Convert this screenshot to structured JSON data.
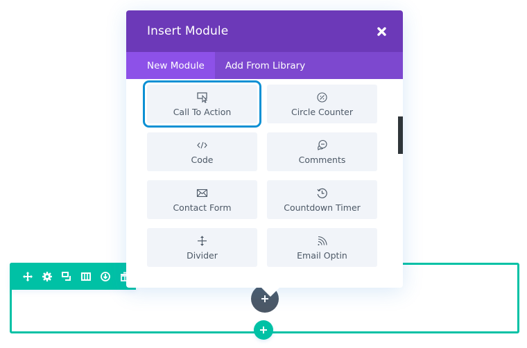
{
  "section": {
    "toolbar": {
      "icons": [
        {
          "name": "move-icon"
        },
        {
          "name": "gear-icon"
        },
        {
          "name": "duplicate-icon"
        },
        {
          "name": "columns-icon"
        },
        {
          "name": "save-to-library-icon"
        },
        {
          "name": "trash-icon"
        }
      ]
    },
    "add_row_icon": "plus-icon",
    "add_module_icon": "plus-icon"
  },
  "modal": {
    "title": "Insert Module",
    "close_icon": "close-icon",
    "tabs": [
      {
        "label": "New Module",
        "active": true
      },
      {
        "label": "Add From Library",
        "active": false
      }
    ],
    "modules": [
      {
        "label": "Call To Action",
        "icon": "call-to-action-icon",
        "selected": true
      },
      {
        "label": "Circle Counter",
        "icon": "circle-counter-icon",
        "selected": false
      },
      {
        "label": "Code",
        "icon": "code-icon",
        "selected": false
      },
      {
        "label": "Comments",
        "icon": "comments-icon",
        "selected": false
      },
      {
        "label": "Contact Form",
        "icon": "envelope-icon",
        "selected": false
      },
      {
        "label": "Countdown Timer",
        "icon": "countdown-timer-icon",
        "selected": false
      },
      {
        "label": "Divider",
        "icon": "divider-icon",
        "selected": false
      },
      {
        "label": "Email Optin",
        "icon": "rss-icon",
        "selected": false
      }
    ]
  },
  "colors": {
    "header": "#6c39b8",
    "tabs_bar": "#7d48cf",
    "active_tab": "#8d51e8",
    "section_accent": "#00c1a5",
    "selected_outline": "#0c90d4",
    "module_tile": "#f1f4f9",
    "text": "#4c5866"
  }
}
